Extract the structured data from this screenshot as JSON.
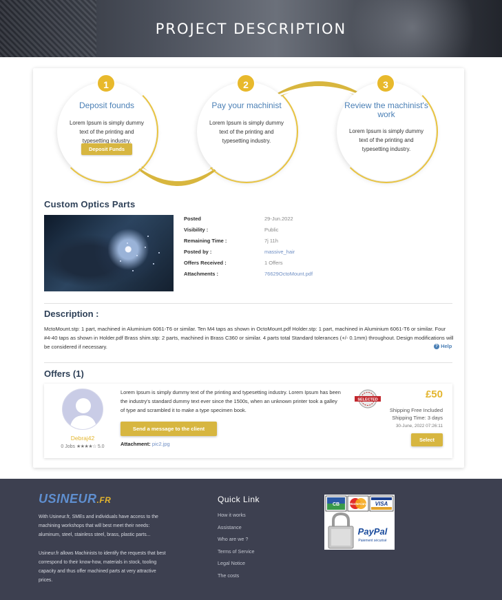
{
  "hero": {
    "title": "PROJECT DESCRIPTION"
  },
  "steps": [
    {
      "num": "1",
      "title": "Deposit founds",
      "desc": "Lorem Ipsum is simply dummy text of the printing and typesetting industry.",
      "button": "Deposit Funds"
    },
    {
      "num": "2",
      "title": "Pay your machinist",
      "desc": "Lorem Ipsum is simply dummy text of the printing and typesetting industry."
    },
    {
      "num": "3",
      "title": "Review the machinist's work",
      "desc": "Lorem Ipsum is simply dummy text of the printing and typesetting industry."
    }
  ],
  "project": {
    "title": "Custom Optics Parts",
    "details": [
      {
        "label": "Posted",
        "value": "29-Jun.2022"
      },
      {
        "label": "Visibility :",
        "value": "Public"
      },
      {
        "label": "Remaining Time :",
        "value": "7j 11h"
      },
      {
        "label": "Posted by :",
        "value": "massive_hair"
      },
      {
        "label": "Offers Received :",
        "value": "1 Offers"
      },
      {
        "label": "Attachments :",
        "value": "76629OctoMount.pdf"
      }
    ]
  },
  "description": {
    "title": "Description :",
    "text": "MctoMount.stp: 1 part, machined in Aluminium 6061-T6 or similar. Ten M4 taps as shown in OctoMount.pdf Holder.stp: 1 part, machined in Aluminium 6061-T6 or similar. Four #4-40 taps as shown in Holder.pdf Brass shim.stp: 2 parts, machined in Brass C360 or similar. 4 parts total Standard tolerances (+/- 0.1mm) throughout. Design modifications will be considered if necessary.",
    "help": "Help"
  },
  "offers": {
    "title": "Offers (1)",
    "items": [
      {
        "name": "Debraj42",
        "jobs": "0 Jobs",
        "rating": "5.0",
        "text": "Lorem Ipsum is simply dummy text of the printing and typesetting industry. Lorem Ipsum has been the industry's standard dummy text ever since the 1500s, when an unknown printer took a galley of type and scrambled it to make a type specimen book.",
        "message_button": "Send a message to the client",
        "attachment_label": "Attachment:",
        "attachment_file": "pic2.jpg",
        "badge": "SELECTED",
        "price": "£50",
        "shipping": "Shipping Free Included",
        "shipping_time": "Shipping Time: 3 days",
        "date": "30-June, 2022 07:26:11",
        "select_button": "Select"
      }
    ]
  },
  "footer": {
    "logo_main": "USINEUR",
    "logo_tld": ".FR",
    "about_1": "With Usineur.fr, SMEs and individuals have access to the machining workshops that will best meet their needs: aluminum, steel, stainless steel, brass, plastic parts...",
    "about_2": "Usineur.fr allows Machinists to identify the requests that best correspond to their know-how, materials in stock, tooling capacity and thus offer machined parts at very attractive prices.",
    "quick_link_title": "Quick Link",
    "links": [
      "How it works",
      "Assistance",
      "Who are we ?",
      "Terms of Service",
      "Legal Notice",
      "The costs"
    ],
    "payments": {
      "cb": "CB",
      "mastercard": "MasterCard",
      "visa": "VISA",
      "paypal": "PayPal",
      "paypal_sub": "Paiement sécurisé"
    }
  },
  "colors": {
    "accent": "#e3b52e",
    "title_blue": "#2e4057",
    "link": "#6f8fc4",
    "footer_bg": "#3d4050"
  }
}
